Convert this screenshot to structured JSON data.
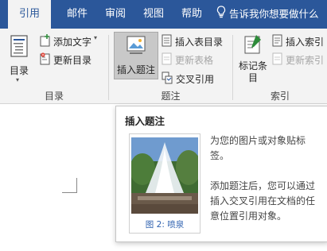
{
  "tabs": [
    {
      "label": "引用",
      "active": true
    },
    {
      "label": "邮件",
      "active": false
    },
    {
      "label": "审阅",
      "active": false
    },
    {
      "label": "视图",
      "active": false
    },
    {
      "label": "帮助",
      "active": false
    }
  ],
  "tell_me": "告诉我你想要做什么",
  "groups": {
    "toc": {
      "label": "目录",
      "toc_button": "目录",
      "add_text": "添加文字",
      "update_toc": "更新目录"
    },
    "captions": {
      "label": "题注",
      "insert_caption": "插入题注",
      "insert_table_of_figures": "插入表目录",
      "update_table": "更新表格",
      "cross_reference": "交叉引用"
    },
    "index": {
      "label": "索引",
      "mark_entry": "标记条目",
      "insert_index": "插入索引",
      "update_index": "更新索引"
    }
  },
  "tooltip": {
    "title": "插入题注",
    "caption": "图 2: 喷泉",
    "desc1": "为您的图片或对象贴标签。",
    "desc2": "添加题注后，您可以通过插入交叉引用在文档的任意位置引用对象。"
  },
  "colors": {
    "tab_bar": "#2b579a",
    "ribbon": "#f3f3f3",
    "caption_text": "#2f62b0"
  }
}
